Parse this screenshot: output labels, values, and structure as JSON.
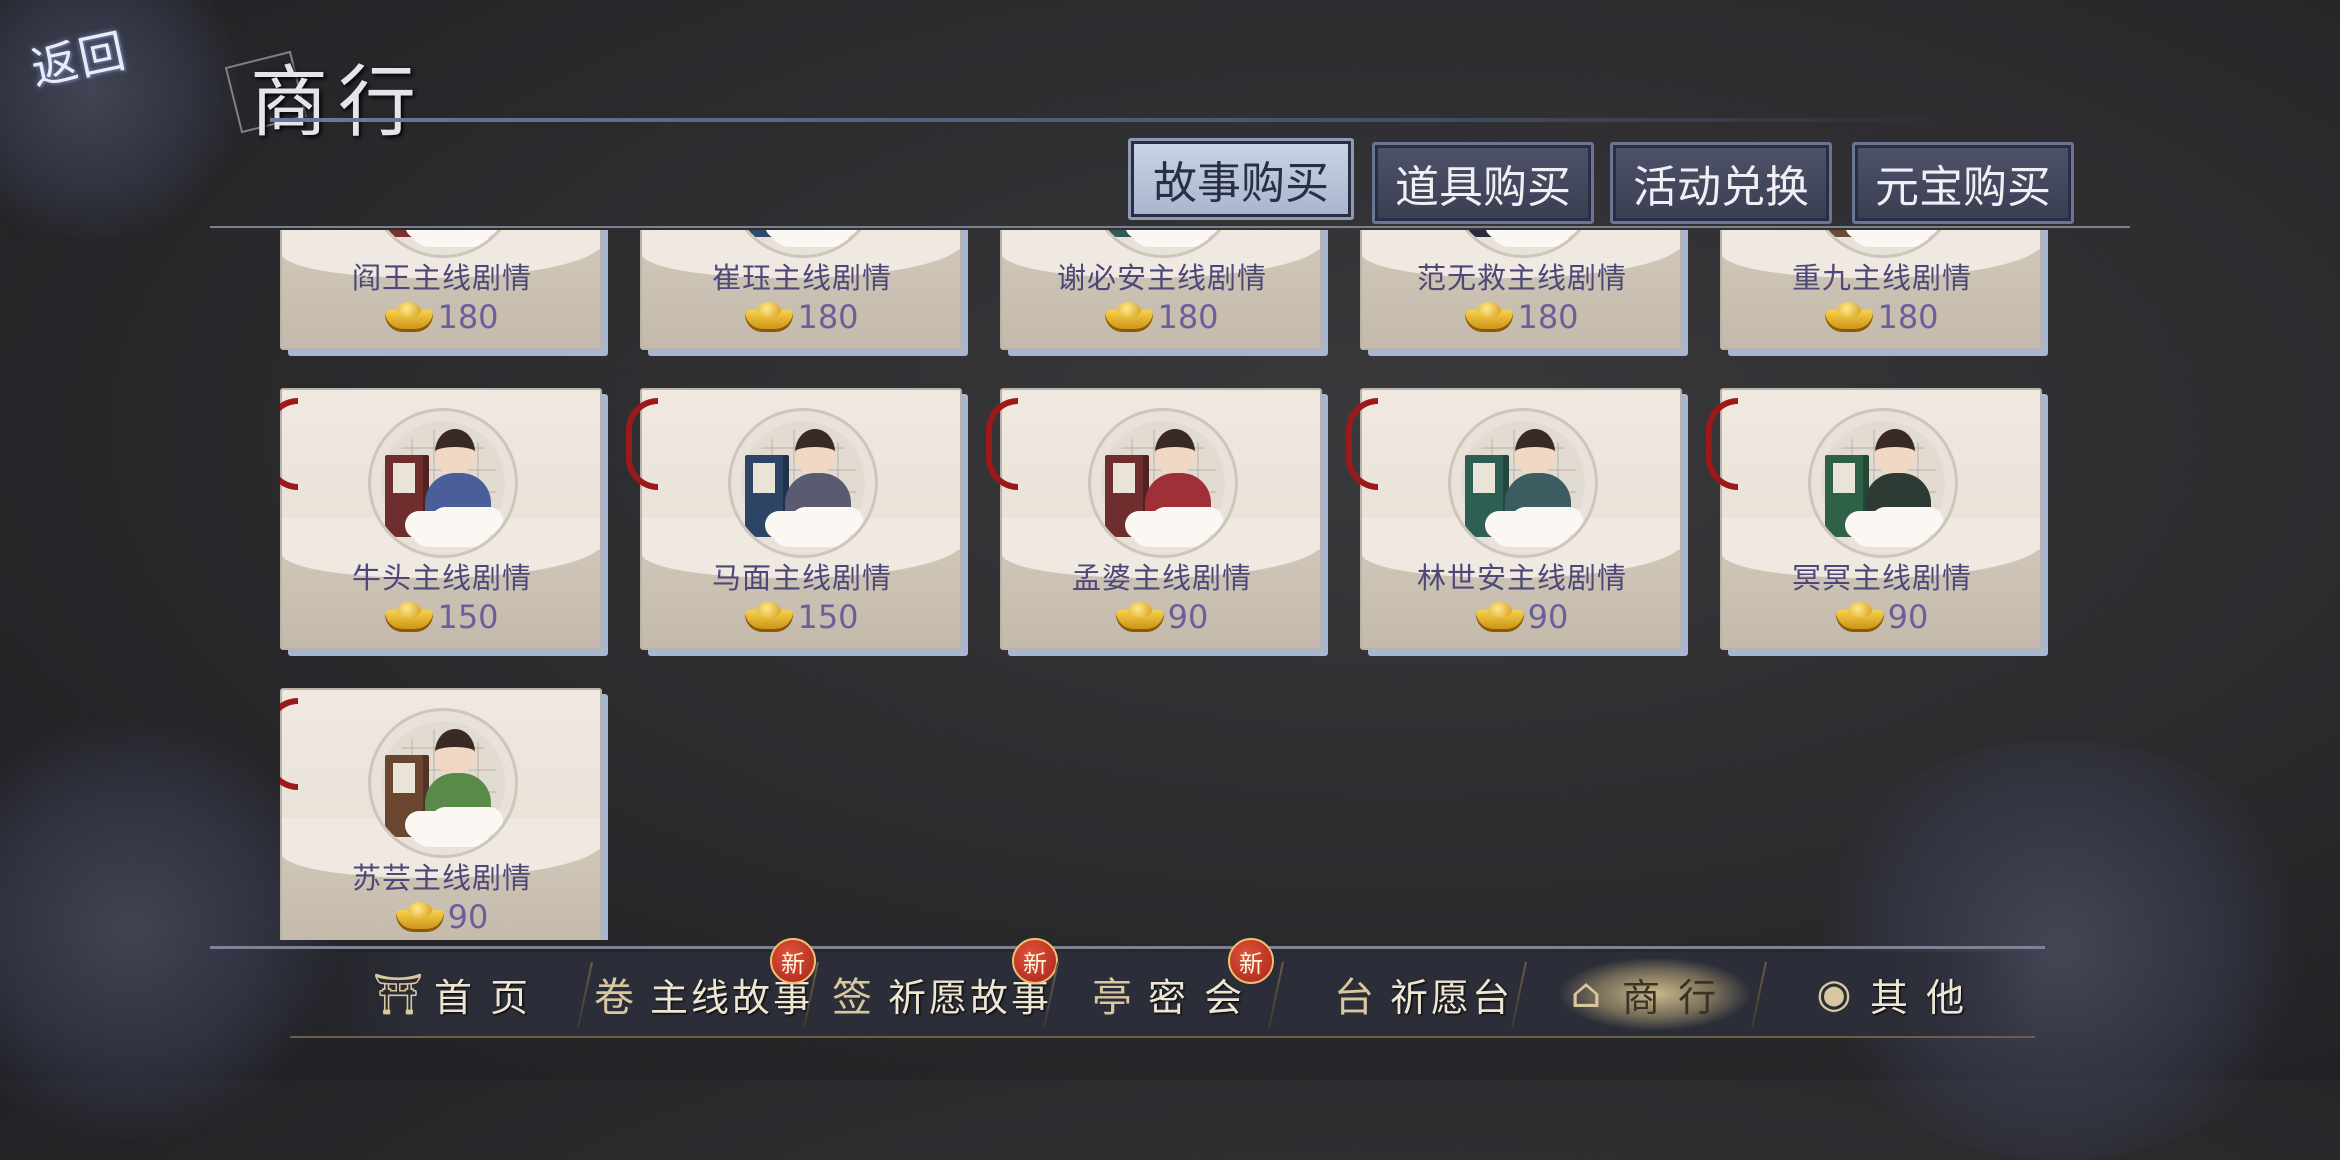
{
  "header": {
    "back_label": "返回",
    "title": "商行"
  },
  "tabs": [
    {
      "label": "故事购买",
      "active": true
    },
    {
      "label": "道具购买",
      "active": false
    },
    {
      "label": "活动兑换",
      "active": false
    },
    {
      "label": "元宝购买",
      "active": false
    }
  ],
  "items": [
    {
      "name": "阎王主线剧情",
      "price": "180",
      "book_color": "#7a3030",
      "outfit": "#6b4a7a"
    },
    {
      "name": "崔珏主线剧情",
      "price": "180",
      "book_color": "#2e4a6a",
      "outfit": "#3a4a70"
    },
    {
      "name": "谢必安主线剧情",
      "price": "180",
      "book_color": "#2f5a55",
      "outfit": "#e8e4ee"
    },
    {
      "name": "范无救主线剧情",
      "price": "180",
      "book_color": "#2a2a40",
      "outfit": "#30303c"
    },
    {
      "name": "重九主线剧情",
      "price": "180",
      "book_color": "#6a4a30",
      "outfit": "#8a3a3a"
    },
    {
      "name": "牛头主线剧情",
      "price": "150",
      "book_color": "#6e2e2e",
      "outfit": "#4a5f9a"
    },
    {
      "name": "马面主线剧情",
      "price": "150",
      "book_color": "#2c4565",
      "outfit": "#5a5a70"
    },
    {
      "name": "孟婆主线剧情",
      "price": "90",
      "book_color": "#6e2e2e",
      "outfit": "#a03038"
    },
    {
      "name": "林世安主线剧情",
      "price": "90",
      "book_color": "#2f5e55",
      "outfit": "#3b5c60"
    },
    {
      "name": "冥冥主线剧情",
      "price": "90",
      "book_color": "#2f6048",
      "outfit": "#2e3a34"
    },
    {
      "name": "苏芸主线剧情",
      "price": "90",
      "book_color": "#6a4530",
      "outfit": "#5a8a4a"
    }
  ],
  "nav": [
    {
      "label": "首 页",
      "icon": "gate-icon",
      "glyph": "⛩",
      "badge": ""
    },
    {
      "label": "主线故事",
      "icon": "scroll-icon",
      "glyph": "卷",
      "badge": "新"
    },
    {
      "label": "祈愿故事",
      "icon": "lot-icon",
      "glyph": "签",
      "badge": "新"
    },
    {
      "label": "密 会",
      "icon": "pavilion-icon",
      "glyph": "亭",
      "badge": "新"
    },
    {
      "label": "祈愿台",
      "icon": "altar-icon",
      "glyph": "台",
      "badge": ""
    },
    {
      "label": "商 行",
      "icon": "shop-icon",
      "glyph": "⌂",
      "badge": ""
    },
    {
      "label": "其 他",
      "icon": "pouch-icon",
      "glyph": "◉",
      "badge": ""
    }
  ],
  "colors": {
    "accent": "#c9d4e6",
    "price_text": "#6a5f9a",
    "badge": "#c0392b"
  }
}
